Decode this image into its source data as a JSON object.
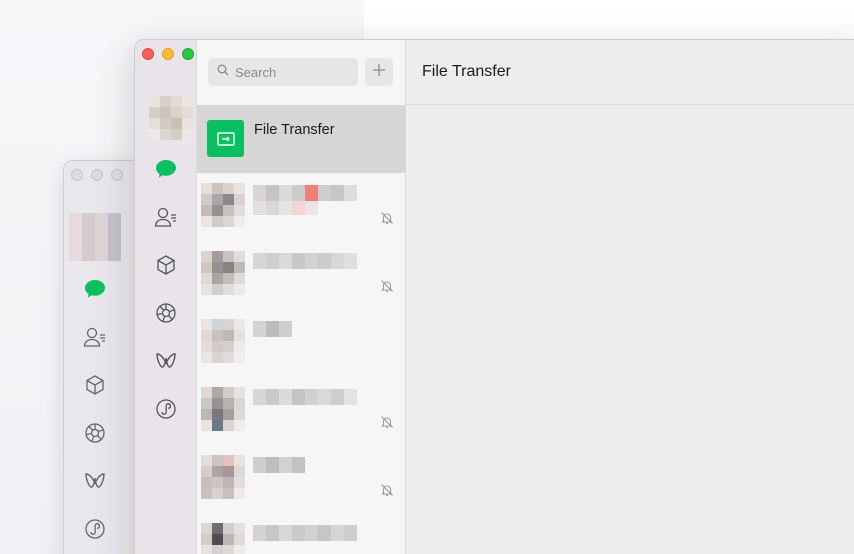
{
  "search": {
    "placeholder": "Search"
  },
  "chats": [
    {
      "name": "File Transfer",
      "selected": true
    }
  ],
  "main": {
    "title": "File Transfer"
  },
  "truncation": "...",
  "colors": {
    "accent_green": "#07c160",
    "close": "#fe5f57",
    "minimize": "#febc2e",
    "maximize": "#28c840"
  },
  "icons": [
    "chat-icon",
    "contacts-icon",
    "favorites-icon",
    "moments-icon",
    "channels-icon",
    "mini-programs-icon",
    "search-icon",
    "plus-icon",
    "muted-bell-icon"
  ]
}
